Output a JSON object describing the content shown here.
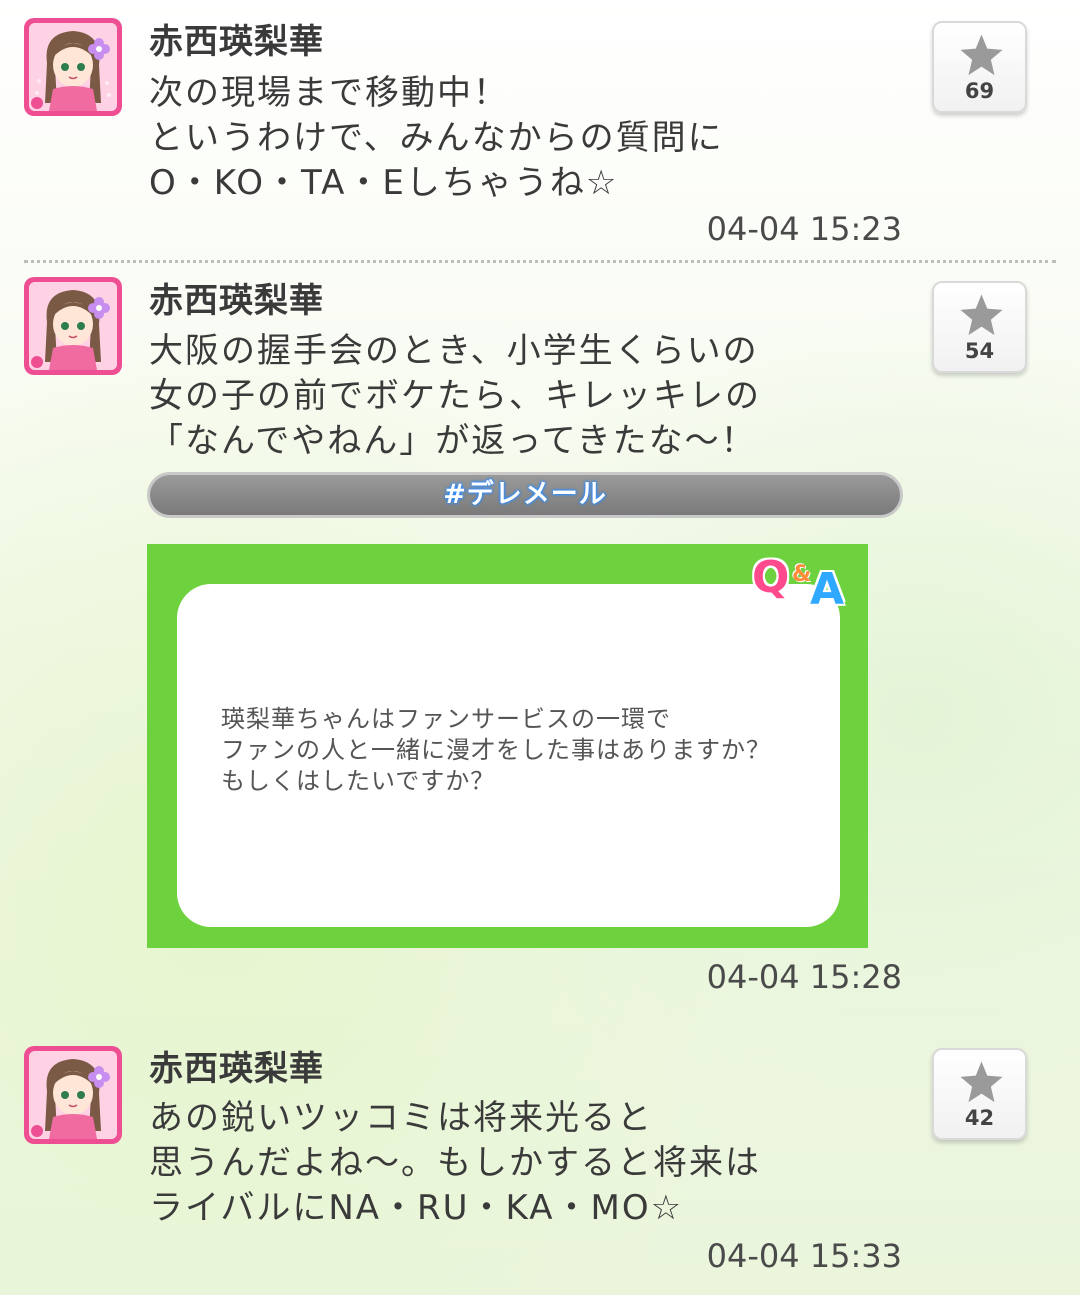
{
  "posts": [
    {
      "author": "赤西瑛梨華",
      "text": "次の現場まで移動中！\nというわけで、みんなからの質問に\nO・KO・TA・Eしちゃうね☆",
      "time": "04-04 15:23",
      "likes": "69"
    },
    {
      "author": "赤西瑛梨華",
      "text": "大阪の握手会のとき、小学生くらいの\n女の子の前でボケたら、キレッキレの\n「なんでやねん」が返ってきたな～！",
      "hashtag": "#デレメール",
      "qa_logo": {
        "q": "Q",
        "amp": "&",
        "a": "A"
      },
      "question": "瑛梨華ちゃんはファンサービスの一環で\nファンの人と一緒に漫才をした事はありますか？\nもしくはしたいですか？",
      "time": "04-04 15:28",
      "likes": "54"
    },
    {
      "author": "赤西瑛梨華",
      "text": "あの鋭いツッコミは将来光ると\n思うんだよね～。もしかすると将来は\nライバルにNA・RU・KA・MO☆",
      "time": "04-04 15:33",
      "likes": "42"
    }
  ],
  "icons": {
    "favorite": "star-icon",
    "avatar": "character-avatar"
  },
  "colors": {
    "avatar_border": "#ee4f93",
    "qa_card_green": "#6dd23e",
    "hashtag_glow": "#2d8cff",
    "star_gray": "#9a9a9a"
  }
}
